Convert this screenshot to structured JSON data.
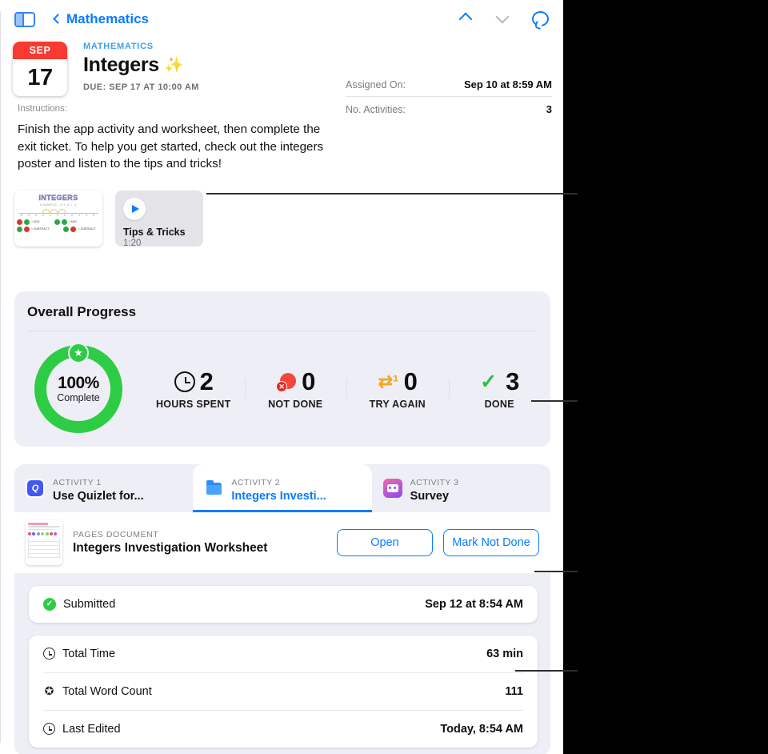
{
  "toolbar": {
    "sidebar_toggle": "sidebar-toggle",
    "back_label": "Mathematics",
    "prev_icon": "chevron-up-icon",
    "next_icon": "chevron-down-icon",
    "comment_icon": "speech-bubble-icon"
  },
  "assignment": {
    "calendar": {
      "month": "SEP",
      "day": "17"
    },
    "course": "MATHEMATICS",
    "title": "Integers",
    "sparkle": "✨",
    "due": "DUE: SEP 17 AT 10:00 AM",
    "meta": [
      {
        "key": "Assigned On:",
        "value": "Sep 10 at 8:59 AM"
      },
      {
        "key": "No. Activities:",
        "value": "3"
      }
    ]
  },
  "instructions": {
    "label": "Instructions:",
    "body": "Finish the app activity and worksheet, then complete the exit ticket. To help you get started, check out the integers poster and listen to the tips and tricks!"
  },
  "attachments": {
    "poster": {
      "title": "INTEGERS",
      "subtitle": "EXAMPLE: -5 + 4 = -1",
      "ticks": [
        "-5",
        "-4",
        "-3",
        "-2",
        "-1",
        "0",
        "1",
        "2",
        "3",
        "4",
        "5"
      ],
      "left_label": "negative",
      "right_label": "positive",
      "rows": [
        {
          "signs": [
            "r",
            "g"
          ],
          "text": "= ADD"
        },
        {
          "signs": [
            "g",
            "r"
          ],
          "text": "= SUBTRACT"
        }
      ],
      "rows_right": [
        {
          "signs": [
            "g",
            "g"
          ],
          "text": "= ADD"
        },
        {
          "signs": [
            "g",
            "r"
          ],
          "text": "= SUBTRACT"
        }
      ]
    },
    "audio": {
      "icon": "play-icon",
      "title": "Tips & Tricks",
      "duration": "1:20"
    }
  },
  "progress": {
    "heading": "Overall Progress",
    "ring": {
      "percent": 100,
      "percent_label": "100%",
      "caption": "Complete",
      "badge_icon": "star-icon",
      "ring_color": "#2ecc45"
    },
    "stats": [
      {
        "icon": "clock-icon",
        "value": "2",
        "label": "HOURS SPENT",
        "color": "#111111"
      },
      {
        "icon": "person-x-icon",
        "value": "0",
        "label": "NOT DONE",
        "color": "#f2473c"
      },
      {
        "icon": "try-again-icon",
        "value": "0",
        "label": "TRY AGAIN",
        "color": "#f5a623"
      },
      {
        "icon": "check-icon",
        "value": "3",
        "label": "DONE",
        "color": "#25c13f"
      }
    ]
  },
  "activities": {
    "tabs": [
      {
        "key": "ACTIVITY 1",
        "label": "Use Quizlet for...",
        "icon": "quizlet-app-icon",
        "active": false
      },
      {
        "key": "ACTIVITY 2",
        "label": "Integers Investi...",
        "icon": "folder-icon",
        "active": true
      },
      {
        "key": "ACTIVITY 3",
        "label": "Survey",
        "icon": "survey-app-icon",
        "active": false
      }
    ],
    "document": {
      "kind": "PAGES DOCUMENT",
      "name": "Integers Investigation Worksheet",
      "thumbnail_icon": "document-thumbnail",
      "open_label": "Open",
      "mark_label": "Mark Not Done"
    },
    "submitted": {
      "icon": "check-circle-icon",
      "label": "Submitted",
      "value": "Sep 12 at 8:54 AM"
    },
    "info": [
      {
        "icon": "clock-icon",
        "key": "Total Time",
        "value": "63 min"
      },
      {
        "icon": "seal-check-icon",
        "key": "Total Word Count",
        "value": "111"
      },
      {
        "icon": "clock-icon",
        "key": "Last Edited",
        "value": "Today, 8:54 AM"
      }
    ]
  },
  "colors": {
    "accent_blue": "#0a7cff",
    "green": "#2ecc45",
    "red": "#f2473c",
    "orange": "#f5a623",
    "card_bg": "#eeeef6"
  }
}
